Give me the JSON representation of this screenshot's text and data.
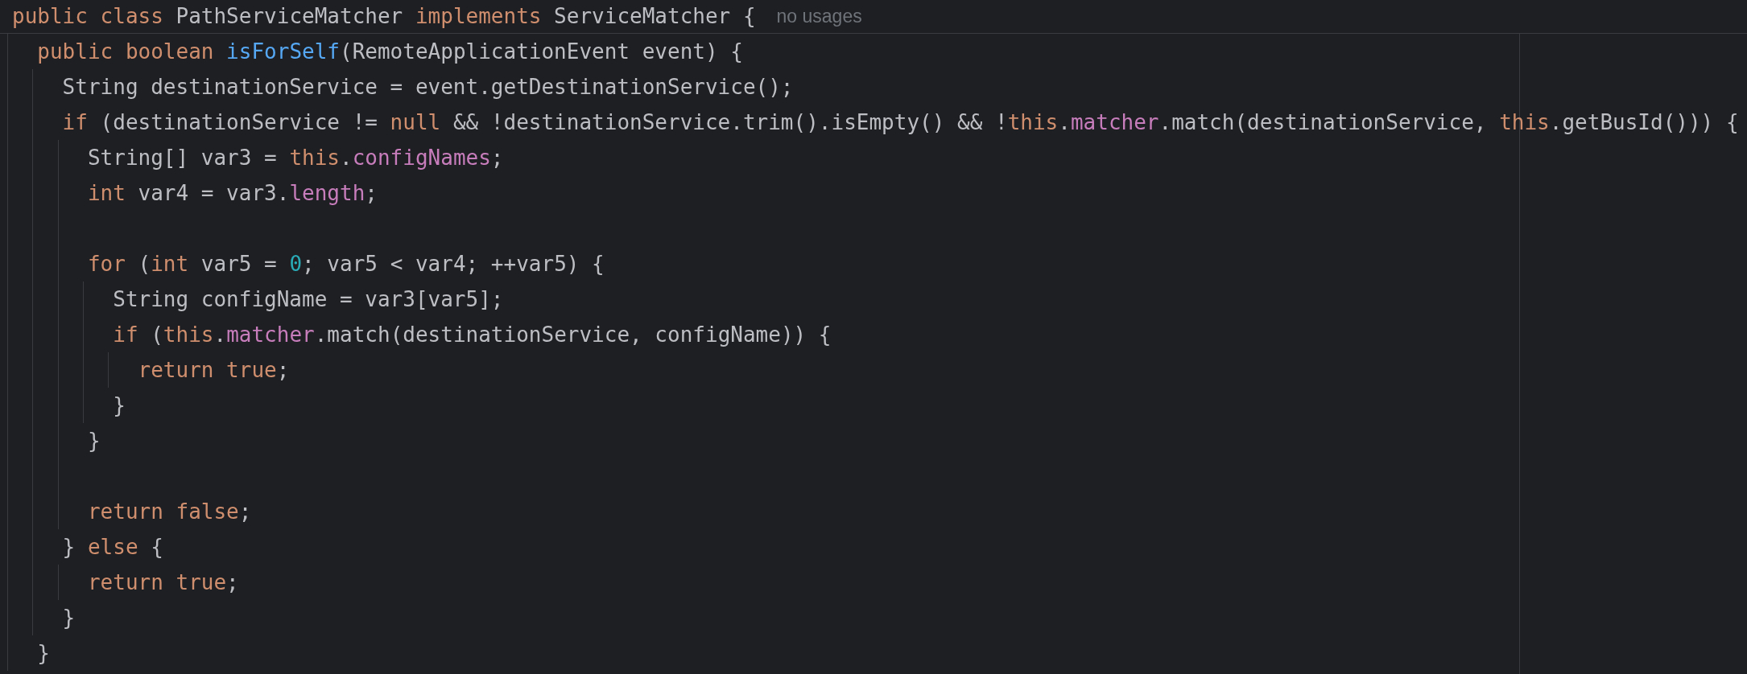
{
  "header": {
    "tokens": [
      {
        "text": "public class ",
        "kind": "keyword"
      },
      {
        "text": "PathServiceMatcher ",
        "kind": "plain"
      },
      {
        "text": "implements ",
        "kind": "keyword"
      },
      {
        "text": "ServiceMatcher {",
        "kind": "plain"
      }
    ],
    "hint": "no usages"
  },
  "lines": [
    {
      "kind": "code",
      "tokens": [
        {
          "text": "  public boolean ",
          "kind": "keyword"
        },
        {
          "text": "isForSelf",
          "kind": "declaration"
        },
        {
          "text": "(RemoteApplicationEvent event) {",
          "kind": "plain"
        }
      ]
    },
    {
      "kind": "code",
      "tokens": [
        {
          "text": "    String destinationService = event.getDestinationService();",
          "kind": "plain"
        }
      ]
    },
    {
      "kind": "code",
      "tokens": [
        {
          "text": "    if",
          "kind": "keyword"
        },
        {
          "text": " (destinationService != ",
          "kind": "plain"
        },
        {
          "text": "null",
          "kind": "keyword"
        },
        {
          "text": " && !destinationService.trim().isEmpty() && !",
          "kind": "plain"
        },
        {
          "text": "this",
          "kind": "keyword"
        },
        {
          "text": ".matcher",
          "kind": "member"
        },
        {
          "text": ".match(destinationService, ",
          "kind": "plain"
        },
        {
          "text": "this",
          "kind": "keyword"
        },
        {
          "text": ".getBusId())) {",
          "kind": "plain"
        }
      ]
    },
    {
      "kind": "code",
      "tokens": [
        {
          "text": "      String[] var3 = ",
          "kind": "plain"
        },
        {
          "text": "this",
          "kind": "keyword"
        },
        {
          "text": ".configNames",
          "kind": "member"
        },
        {
          "text": ";",
          "kind": "plain"
        }
      ]
    },
    {
      "kind": "code",
      "tokens": [
        {
          "text": "      int",
          "kind": "keyword"
        },
        {
          "text": " var4 = var3.",
          "kind": "plain"
        },
        {
          "text": "length",
          "kind": "field"
        },
        {
          "text": ";",
          "kind": "plain"
        }
      ]
    },
    {
      "kind": "blank"
    },
    {
      "kind": "code",
      "tokens": [
        {
          "text": "      for",
          "kind": "keyword"
        },
        {
          "text": " (",
          "kind": "plain"
        },
        {
          "text": "int",
          "kind": "keyword"
        },
        {
          "text": " var5 = ",
          "kind": "plain"
        },
        {
          "text": "0",
          "kind": "number"
        },
        {
          "text": "; var5 < var4; ++var5) {",
          "kind": "plain"
        }
      ]
    },
    {
      "kind": "code",
      "tokens": [
        {
          "text": "        String configName = var3[var5];",
          "kind": "plain"
        }
      ]
    },
    {
      "kind": "code",
      "tokens": [
        {
          "text": "        if",
          "kind": "keyword"
        },
        {
          "text": " (",
          "kind": "plain"
        },
        {
          "text": "this",
          "kind": "keyword"
        },
        {
          "text": ".matcher",
          "kind": "member"
        },
        {
          "text": ".match(destinationService, configName)) {",
          "kind": "plain"
        }
      ]
    },
    {
      "kind": "code",
      "tokens": [
        {
          "text": "          return true",
          "kind": "keyword"
        },
        {
          "text": ";",
          "kind": "plain"
        }
      ]
    },
    {
      "kind": "code",
      "tokens": [
        {
          "text": "        }",
          "kind": "plain"
        }
      ]
    },
    {
      "kind": "code",
      "tokens": [
        {
          "text": "      }",
          "kind": "plain"
        }
      ]
    },
    {
      "kind": "blank"
    },
    {
      "kind": "code",
      "tokens": [
        {
          "text": "      return false",
          "kind": "keyword"
        },
        {
          "text": ";",
          "kind": "plain"
        }
      ]
    },
    {
      "kind": "code",
      "tokens": [
        {
          "text": "    } ",
          "kind": "plain"
        },
        {
          "text": "else",
          "kind": "keyword"
        },
        {
          "text": " {",
          "kind": "plain"
        }
      ]
    },
    {
      "kind": "code",
      "tokens": [
        {
          "text": "      return true",
          "kind": "keyword"
        },
        {
          "text": ";",
          "kind": "plain"
        }
      ]
    },
    {
      "kind": "code",
      "tokens": [
        {
          "text": "    }",
          "kind": "plain"
        }
      ]
    },
    {
      "kind": "code",
      "tokens": [
        {
          "text": "  }",
          "kind": "plain"
        }
      ]
    }
  ]
}
